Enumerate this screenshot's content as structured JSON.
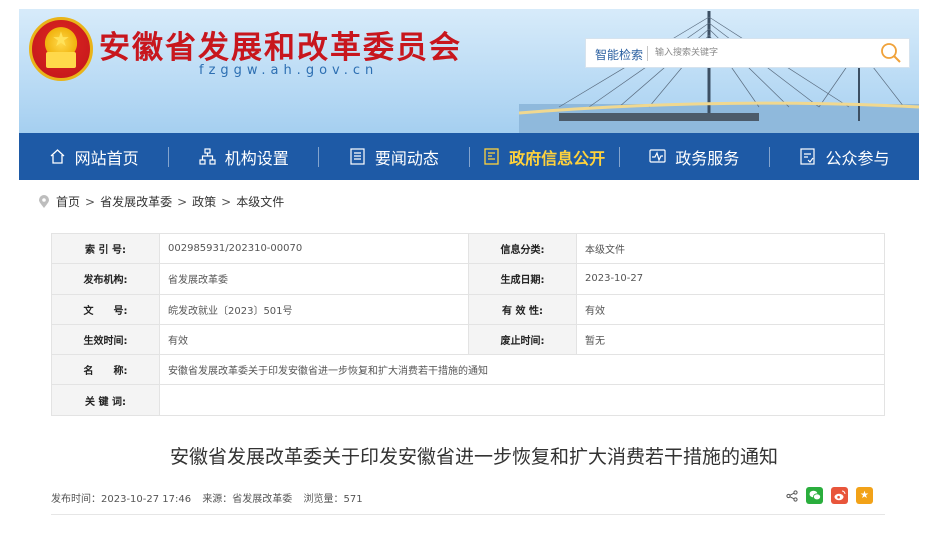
{
  "header": {
    "site_title": "安徽省发展和改革委员会",
    "site_domain": "fzggw.ah.gov.cn",
    "search": {
      "label": "智能检索",
      "placeholder": "输入搜索关键字"
    }
  },
  "nav": [
    {
      "label": "网站首页",
      "icon": "home-icon"
    },
    {
      "label": "机构设置",
      "icon": "org-chart-icon"
    },
    {
      "label": "要闻动态",
      "icon": "document-icon"
    },
    {
      "label": "政府信息公开",
      "icon": "info-disclosure-icon",
      "active": true
    },
    {
      "label": "政务服务",
      "icon": "service-icon"
    },
    {
      "label": "公众参与",
      "icon": "participation-icon"
    }
  ],
  "breadcrumb": [
    "首页",
    "省发展改革委",
    "政策",
    "本级文件"
  ],
  "info": {
    "index_label": "索 引 号:",
    "index_value": "002985931/202310-00070",
    "category_label": "信息分类:",
    "category_value": "本级文件",
    "publisher_label": "发布机构:",
    "publisher_value": "省发展改革委",
    "created_label": "生成日期:",
    "created_value": "2023-10-27",
    "docno_label": "文　　号:",
    "docno_value": "皖发改就业〔2023〕501号",
    "validity_label": "有 效 性:",
    "validity_value": "有效",
    "effective_label": "生效时间:",
    "effective_value": "有效",
    "abolish_label": "废止时间:",
    "abolish_value": "暂无",
    "name_label": "名　　称:",
    "name_value": "安徽省发展改革委关于印发安徽省进一步恢复和扩大消费若干措施的通知",
    "keywords_label": "关 键 词:",
    "keywords_value": ""
  },
  "article": {
    "title": "安徽省发展改革委关于印发安徽省进一步恢复和扩大消费若干措施的通知",
    "publish_time": "发布时间：2023-10-27 17:46",
    "source": "来源：省发展改革委",
    "views": "浏览量：571"
  },
  "colors": {
    "nav_bg": "#1e5aa6",
    "title_red": "#c8161d",
    "active_nav": "#ffd23c",
    "wechat": "#2aae3d",
    "weibo": "#e8553b",
    "favorite": "#f2a218"
  }
}
